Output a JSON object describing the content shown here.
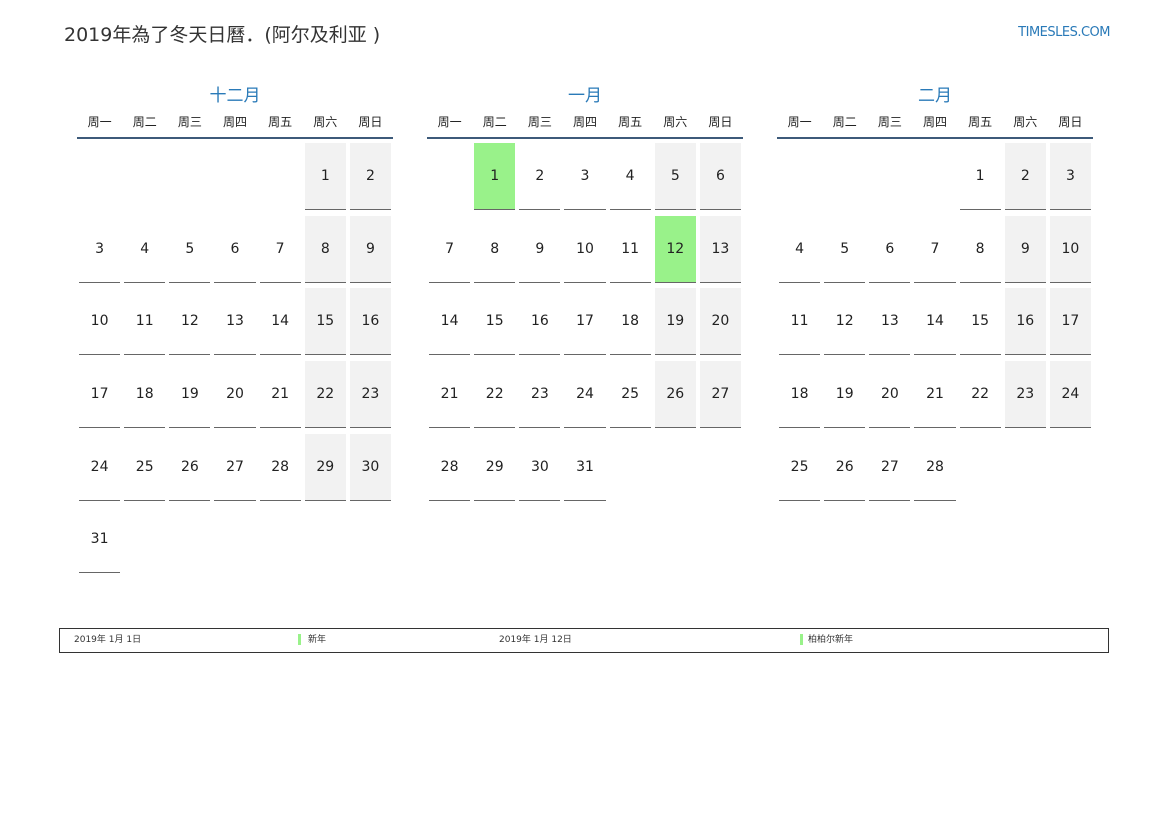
{
  "header": {
    "title": "2019年為了冬天日曆．(阿尔及利亚 )",
    "site": "TIMESLES.COM"
  },
  "weekdays": [
    "周一",
    "周二",
    "周三",
    "周四",
    "周五",
    "周六",
    "周日"
  ],
  "months": [
    {
      "name": "十二月",
      "weeks": [
        [
          "",
          "",
          "",
          "",
          "",
          "1",
          "2"
        ],
        [
          "3",
          "4",
          "5",
          "6",
          "7",
          "8",
          "9"
        ],
        [
          "10",
          "11",
          "12",
          "13",
          "14",
          "15",
          "16"
        ],
        [
          "17",
          "18",
          "19",
          "20",
          "21",
          "22",
          "23"
        ],
        [
          "24",
          "25",
          "26",
          "27",
          "28",
          "29",
          "30"
        ],
        [
          "31",
          "",
          "",
          "",
          "",
          "",
          ""
        ]
      ],
      "holidays": []
    },
    {
      "name": "一月",
      "weeks": [
        [
          "",
          "1",
          "2",
          "3",
          "4",
          "5",
          "6"
        ],
        [
          "7",
          "8",
          "9",
          "10",
          "11",
          "12",
          "13"
        ],
        [
          "14",
          "15",
          "16",
          "17",
          "18",
          "19",
          "20"
        ],
        [
          "21",
          "22",
          "23",
          "24",
          "25",
          "26",
          "27"
        ],
        [
          "28",
          "29",
          "30",
          "31",
          "",
          "",
          ""
        ]
      ],
      "holidays": [
        "1",
        "12"
      ]
    },
    {
      "name": "二月",
      "weeks": [
        [
          "",
          "",
          "",
          "",
          "1",
          "2",
          "3"
        ],
        [
          "4",
          "5",
          "6",
          "7",
          "8",
          "9",
          "10"
        ],
        [
          "11",
          "12",
          "13",
          "14",
          "15",
          "16",
          "17"
        ],
        [
          "18",
          "19",
          "20",
          "21",
          "22",
          "23",
          "24"
        ],
        [
          "25",
          "26",
          "27",
          "28",
          "",
          "",
          ""
        ]
      ],
      "holidays": []
    }
  ],
  "colors": {
    "holiday": "#99f28a",
    "weekend": "#f2f2f2",
    "accent": "#2a7ab8"
  },
  "legend": [
    {
      "date": "2019年 1月 1日",
      "name": "新年"
    },
    {
      "date": "2019年 1月 12日",
      "name": "柏柏尔新年"
    }
  ]
}
